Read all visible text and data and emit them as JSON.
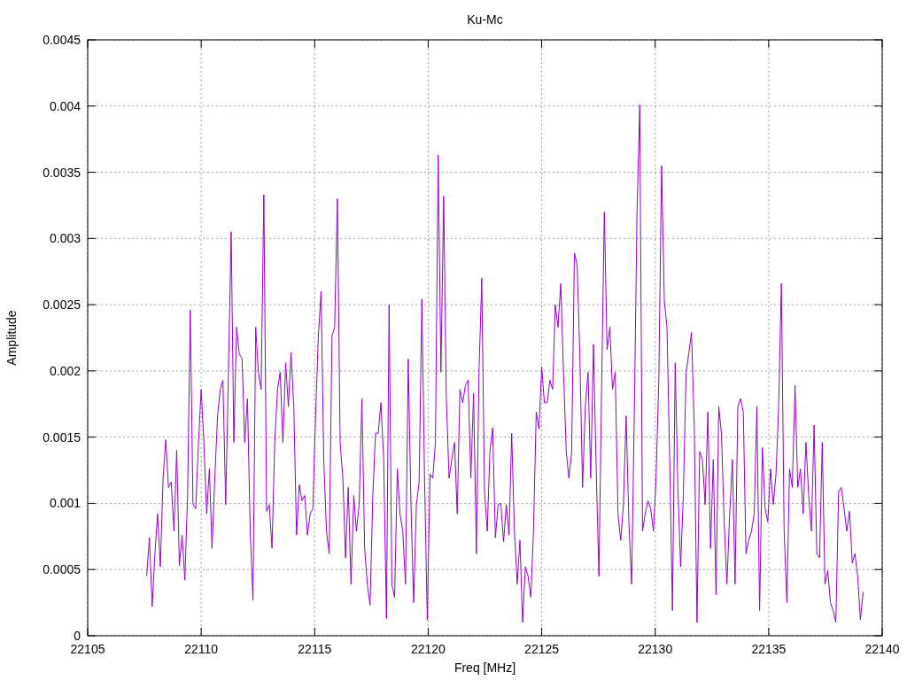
{
  "chart": {
    "chart_data": {
      "type": "line",
      "title": "Ku-Mc",
      "xlabel": "Freq [MHz]",
      "ylabel": "Amplitude",
      "xlim": [
        22105,
        22140
      ],
      "ylim": [
        0,
        0.0045
      ],
      "xticks": [
        22105,
        22110,
        22115,
        22120,
        22125,
        22130,
        22135,
        22140
      ],
      "yticks": [
        0,
        0.0005,
        0.001,
        0.0015,
        0.002,
        0.0025,
        0.003,
        0.0035,
        0.004,
        0.0045
      ],
      "x": [
        22107.6,
        22107.72,
        22107.84,
        22107.96,
        22108.08,
        22108.2,
        22108.32,
        22108.44,
        22108.56,
        22108.68,
        22108.8,
        22108.92,
        22109.04,
        22109.16,
        22109.28,
        22109.4,
        22109.52,
        22109.64,
        22109.76,
        22109.88,
        22110.0,
        22110.12,
        22110.24,
        22110.36,
        22110.48,
        22110.6,
        22110.72,
        22110.84,
        22110.96,
        22111.08,
        22111.2,
        22111.32,
        22111.44,
        22111.56,
        22111.68,
        22111.8,
        22111.92,
        22112.04,
        22112.16,
        22112.28,
        22112.4,
        22112.52,
        22112.64,
        22112.76,
        22112.88,
        22113.0,
        22113.12,
        22113.24,
        22113.36,
        22113.48,
        22113.6,
        22113.72,
        22113.84,
        22113.96,
        22114.08,
        22114.2,
        22114.32,
        22114.44,
        22114.56,
        22114.68,
        22114.8,
        22114.92,
        22115.04,
        22115.16,
        22115.28,
        22115.4,
        22115.52,
        22115.64,
        22115.76,
        22115.88,
        22116.0,
        22116.12,
        22116.24,
        22116.36,
        22116.48,
        22116.6,
        22116.72,
        22116.84,
        22116.96,
        22117.08,
        22117.2,
        22117.32,
        22117.44,
        22117.56,
        22117.68,
        22117.8,
        22117.92,
        22118.04,
        22118.16,
        22118.28,
        22118.4,
        22118.52,
        22118.64,
        22118.76,
        22118.88,
        22119.0,
        22119.12,
        22119.24,
        22119.36,
        22119.48,
        22119.6,
        22119.72,
        22119.84,
        22119.96,
        22120.08,
        22120.2,
        22120.32,
        22120.44,
        22120.56,
        22120.68,
        22120.8,
        22120.92,
        22121.04,
        22121.16,
        22121.28,
        22121.4,
        22121.52,
        22121.64,
        22121.76,
        22121.88,
        22122.0,
        22122.12,
        22122.24,
        22122.36,
        22122.48,
        22122.6,
        22122.72,
        22122.84,
        22122.96,
        22123.08,
        22123.2,
        22123.32,
        22123.44,
        22123.56,
        22123.68,
        22123.8,
        22123.92,
        22124.04,
        22124.16,
        22124.28,
        22124.4,
        22124.52,
        22124.64,
        22124.76,
        22124.88,
        22125.0,
        22125.12,
        22125.24,
        22125.36,
        22125.48,
        22125.6,
        22125.72,
        22125.84,
        22125.96,
        22126.08,
        22126.2,
        22126.32,
        22126.44,
        22126.56,
        22126.68,
        22126.8,
        22126.92,
        22127.04,
        22127.16,
        22127.28,
        22127.4,
        22127.52,
        22127.64,
        22127.76,
        22127.88,
        22128.0,
        22128.12,
        22128.24,
        22128.36,
        22128.48,
        22128.6,
        22128.72,
        22128.84,
        22128.96,
        22129.08,
        22129.2,
        22129.32,
        22129.44,
        22129.56,
        22129.68,
        22129.8,
        22129.92,
        22130.04,
        22130.16,
        22130.28,
        22130.4,
        22130.52,
        22130.64,
        22130.76,
        22130.88,
        22131.0,
        22131.12,
        22131.24,
        22131.36,
        22131.48,
        22131.6,
        22131.72,
        22131.84,
        22131.96,
        22132.08,
        22132.2,
        22132.32,
        22132.44,
        22132.56,
        22132.68,
        22132.8,
        22132.92,
        22133.04,
        22133.16,
        22133.28,
        22133.4,
        22133.52,
        22133.64,
        22133.76,
        22133.88,
        22134.0,
        22134.12,
        22134.24,
        22134.36,
        22134.48,
        22134.6,
        22134.72,
        22134.84,
        22134.96,
        22135.08,
        22135.2,
        22135.32,
        22135.44,
        22135.56,
        22135.68,
        22135.8,
        22135.92,
        22136.04,
        22136.16,
        22136.28,
        22136.4,
        22136.52,
        22136.64,
        22136.76,
        22136.88,
        22137.0,
        22137.12,
        22137.24,
        22137.36,
        22137.48,
        22137.6,
        22137.72,
        22137.84,
        22137.96,
        22138.08,
        22138.2,
        22138.32,
        22138.44,
        22138.56,
        22138.68,
        22138.8,
        22138.92,
        22139.04,
        22139.16
      ],
      "grid": true,
      "series": [
        {
          "color": "#9400d3",
          "values": [
            0.00045,
            0.00074,
            0.00022,
            0.00062,
            0.00092,
            0.00052,
            0.00119,
            0.00148,
            0.00112,
            0.00116,
            0.00079,
            0.0014,
            0.00053,
            0.00076,
            0.00042,
            0.00106,
            0.00246,
            0.00099,
            0.00096,
            0.00146,
            0.00186,
            0.00146,
            0.00092,
            0.00126,
            0.00066,
            0.00119,
            0.00166,
            0.00186,
            0.00193,
            0.00099,
            0.00199,
            0.00305,
            0.00146,
            0.00233,
            0.00213,
            0.00209,
            0.00146,
            0.00179,
            0.00079,
            0.00027,
            0.00233,
            0.00199,
            0.00186,
            0.00333,
            0.00094,
            0.00099,
            0.00066,
            0.00146,
            0.00186,
            0.00199,
            0.00146,
            0.00206,
            0.00173,
            0.00214,
            0.00173,
            0.00076,
            0.00114,
            0.00102,
            0.00106,
            0.00076,
            0.00092,
            0.00096,
            0.00166,
            0.00226,
            0.0026,
            0.00133,
            0.00079,
            0.00062,
            0.00226,
            0.00233,
            0.0033,
            0.00146,
            0.00119,
            0.00059,
            0.00112,
            0.00039,
            0.00106,
            0.00079,
            0.00099,
            0.00179,
            0.00066,
            0.00039,
            0.00023,
            0.00106,
            0.00153,
            0.00153,
            0.00176,
            0.00133,
            0.00013,
            0.0025,
            0.00039,
            0.00029,
            0.00126,
            0.00092,
            0.00079,
            0.00039,
            0.00209,
            0.00099,
            0.00025,
            0.00099,
            0.00116,
            0.00254,
            0.00119,
            0.00012,
            0.00122,
            0.00119,
            0.00146,
            0.00363,
            0.00199,
            0.00332,
            0.00179,
            0.00119,
            0.00133,
            0.00146,
            0.00092,
            0.00186,
            0.00176,
            0.00189,
            0.00193,
            0.00119,
            0.00183,
            0.00062,
            0.00199,
            0.0027,
            0.00109,
            0.00079,
            0.00139,
            0.00157,
            0.00074,
            0.00099,
            0.001,
            0.00071,
            0.00099,
            0.00076,
            0.00153,
            0.00079,
            0.00039,
            0.00072,
            0.0001,
            0.00052,
            0.00045,
            0.00029,
            0.00079,
            0.00169,
            0.00156,
            0.00203,
            0.00176,
            0.00176,
            0.00193,
            0.00186,
            0.0025,
            0.00233,
            0.00266,
            0.00199,
            0.00139,
            0.00119,
            0.00139,
            0.00289,
            0.0028,
            0.00213,
            0.00112,
            0.00173,
            0.00199,
            0.00119,
            0.0022,
            0.00126,
            0.00045,
            0.00186,
            0.0032,
            0.00216,
            0.00233,
            0.00186,
            0.00199,
            0.00092,
            0.00072,
            0.00099,
            0.00166,
            0.00086,
            0.00039,
            0.00166,
            0.0032,
            0.00401,
            0.00079,
            0.00092,
            0.00102,
            0.00096,
            0.00079,
            0.00119,
            0.00193,
            0.00355,
            0.00253,
            0.00233,
            0.00133,
            0.00019,
            0.00206,
            0.00112,
            0.00052,
            0.00106,
            0.00199,
            0.00213,
            0.00229,
            0.00159,
            0.0001,
            0.00139,
            0.00133,
            0.00099,
            0.00169,
            0.00066,
            0.00133,
            0.00031,
            0.00173,
            0.00153,
            0.00086,
            0.00039,
            0.00092,
            0.00133,
            0.00039,
            0.00173,
            0.00179,
            0.00169,
            0.00062,
            0.00072,
            0.00079,
            0.00092,
            0.00173,
            0.00019,
            0.00142,
            0.00096,
            0.00086,
            0.00126,
            0.00099,
            0.00122,
            0.00173,
            0.00266,
            0.00079,
            0.00025,
            0.00126,
            0.00112,
            0.00189,
            0.00112,
            0.00126,
            0.00092,
            0.00146,
            0.00106,
            0.00079,
            0.00159,
            0.00062,
            0.00059,
            0.00146,
            0.00039,
            0.00049,
            0.00025,
            0.00019,
            0.0001,
            0.00109,
            0.00112,
            0.00096,
            0.00079,
            0.00094,
            0.00055,
            0.00062,
            0.00045,
            0.00012,
            0.00033
          ]
        }
      ]
    }
  }
}
